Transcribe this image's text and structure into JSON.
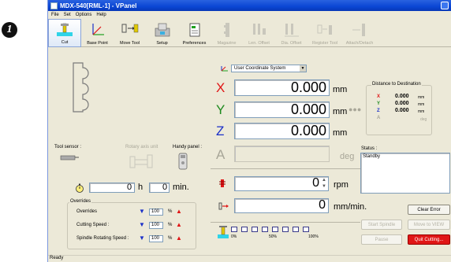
{
  "step_badge": "1",
  "window": {
    "title": "MDX-540[RML-1] - VPanel"
  },
  "menu": [
    "File",
    "Set",
    "Options",
    "Help"
  ],
  "toolbar": [
    {
      "label": "Cut",
      "icon": "cut-icon",
      "enabled": true
    },
    {
      "label": "Base Point",
      "icon": "base-point-icon",
      "enabled": true
    },
    {
      "label": "Move Tool",
      "icon": "move-tool-icon",
      "enabled": true
    },
    {
      "label": "Setup",
      "icon": "setup-icon",
      "enabled": true
    },
    {
      "label": "Preferences",
      "icon": "preferences-icon",
      "enabled": true
    },
    {
      "label": "Magazine",
      "icon": "magazine-icon",
      "enabled": false
    },
    {
      "label": "Len. Offset",
      "icon": "length-offset-icon",
      "enabled": false
    },
    {
      "label": "Dia. Offset",
      "icon": "diameter-offset-icon",
      "enabled": false
    },
    {
      "label": "Register Tool",
      "icon": "register-tool-icon",
      "enabled": false
    },
    {
      "label": "Attach/Detach",
      "icon": "attach-detach-icon",
      "enabled": false
    }
  ],
  "coordinate_system": "User Coordinate System",
  "coords": {
    "x": {
      "label": "X",
      "value": "0.000",
      "unit": "mm"
    },
    "y": {
      "label": "Y",
      "value": "0.000",
      "unit": "mm"
    },
    "z": {
      "label": "Z",
      "value": "0.000",
      "unit": "mm"
    },
    "a": {
      "label": "A",
      "value": "",
      "unit": "deg"
    }
  },
  "distance": {
    "title": "Distance to Destination",
    "x": {
      "label": "X",
      "value": "0.000",
      "unit": "mm"
    },
    "y": {
      "label": "Y",
      "value": "0.000",
      "unit": "mm"
    },
    "z": {
      "label": "Z",
      "value": "0.000",
      "unit": "mm"
    },
    "a": {
      "label": "A",
      "value": "",
      "unit": "deg"
    }
  },
  "devices": {
    "tool_sensor": "Tool sensor :",
    "rotary_axis_unit": "Rotary axis unit",
    "handy_panel": "Handy panel :"
  },
  "spindle": {
    "value": "0",
    "unit": "rpm"
  },
  "feed": {
    "value": "0",
    "unit": "mm/min."
  },
  "timer": {
    "hours": "0",
    "hours_unit": "h",
    "minutes": "0",
    "minutes_unit": "min."
  },
  "status": {
    "label": "Status :",
    "value": "Standby"
  },
  "overrides": {
    "title": "Overrides",
    "rows": [
      {
        "label": "Overrides",
        "value": "100",
        "unit": "%"
      },
      {
        "label": "Cutting Speed :",
        "value": "100",
        "unit": "%"
      },
      {
        "label": "Spindle Rotating Speed :",
        "value": "100",
        "unit": "%"
      }
    ]
  },
  "progress": {
    "ticks": [
      "0%",
      "50%",
      "100%"
    ],
    "percent": 0
  },
  "buttons": {
    "clear_error": "Clear Error",
    "start_spindle": "Start Spindle",
    "move_to_view": "Move to VIEW",
    "pause": "Pause",
    "quit_cutting": "Quit Cutting..."
  },
  "statusbar": "Ready",
  "colors": {
    "x_axis": "#e01616",
    "y_axis": "#1f8a1f",
    "z_axis": "#1a2fc8",
    "a_axis": "#a8a698",
    "quit": "#e01616"
  }
}
